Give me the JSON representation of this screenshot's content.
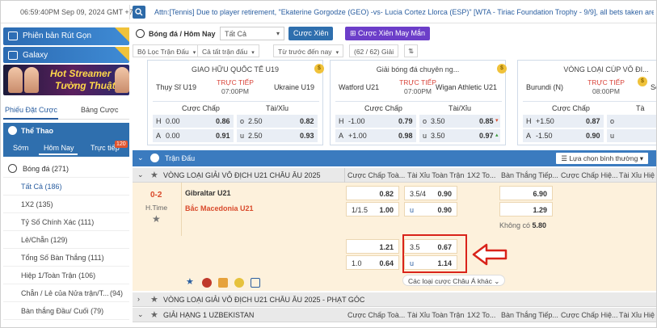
{
  "topbar": {
    "datetime": "06:59:40PM Sep 09, 2024 GMT +7",
    "ticker": "Attn:[Tennis] Due to player retirement, \"Ekaterine Gorgodze (GEO) -vs- Lucia Cortez Llorca (ESP)\" [WTA - Tiriac Foundation Trophy - 9/9], all bets taken are"
  },
  "sidebar": {
    "promo1": "Phiên bản Rút Gọn",
    "promo2": "Galaxy",
    "promo3_line1": "Hot Streamer",
    "promo3_line2": "Tường Thuật",
    "tabs": [
      "Phiếu Đặt Cược",
      "Bảng Cược"
    ],
    "sport_title": "Thể Thao",
    "modes": [
      "Sớm",
      "Hôm Nay",
      "Trực tiếp"
    ],
    "live_badge": "120",
    "items": [
      {
        "label": "Bóng đá",
        "count": "(271)"
      },
      {
        "label": "Tất Cả",
        "count": "(186)"
      },
      {
        "label": "1X2",
        "count": "(135)"
      },
      {
        "label": "Tỷ Số Chính Xác",
        "count": "(111)"
      },
      {
        "label": "Lẻ/Chẵn",
        "count": "(129)"
      },
      {
        "label": "Tổng Số Bàn Thắng",
        "count": "(111)"
      },
      {
        "label": "Hiệp 1/Toàn Trận",
        "count": "(106)"
      },
      {
        "label": "Chẵn / Lẻ của Nửa trận/T...",
        "count": "(94)"
      },
      {
        "label": "Bàn thắng Đầu/ Cuối",
        "count": "(79)"
      }
    ]
  },
  "toolbar": {
    "title": "Bóng đá / Hôm Nay",
    "select_value": "Tất Cả",
    "btn_parlay": "Cược Xiên",
    "btn_lucky": "Cược Xiên May Mắn",
    "filters": [
      "Bộ Lọc Trận Đấu",
      "Cả tất trận đấu",
      "Từ trước đến nay",
      "(62 / 62) Giải"
    ]
  },
  "cards": [
    {
      "league": "GIAO HỮU QUỐC TẾ U19",
      "home": "Thụy Sĩ U19",
      "away": "Ukraine U19",
      "status": "TRỰC TIẾP",
      "time": "07:00PM",
      "hdp_label": "Cược Chấp",
      "ou_label": "Tài/Xỉu",
      "r1": {
        "h": "H",
        "hv": "0.00",
        "ho": "0.86",
        "o": "o",
        "ov": "2.50",
        "oo": "0.82"
      },
      "r2": {
        "h": "A",
        "hv": "0.00",
        "ho": "0.91",
        "o": "u",
        "ov": "2.50",
        "oo": "0.93"
      }
    },
    {
      "league": "Giải bóng đá chuyên ng...",
      "home": "Watford U21",
      "away": "Wigan Athletic U21",
      "status": "TRỰC TIẾP",
      "time": "07:00PM",
      "hdp_label": "Cược Chấp",
      "ou_label": "Tài/Xỉu",
      "r1": {
        "h": "H",
        "hv": "-1.00",
        "ho": "0.79",
        "o": "o",
        "ov": "3.50",
        "oo": "0.85"
      },
      "r2": {
        "h": "A",
        "hv": "+1.00",
        "ho": "0.98",
        "o": "u",
        "ov": "3.50",
        "oo": "0.97"
      }
    },
    {
      "league": "VÒNG LOẠI CÚP VÔ ĐI...",
      "home": "Burundi (N)",
      "away": "Se",
      "status": "TRỰC TIẾP",
      "time": "08:00PM",
      "hdp_label": "Cược Chấp",
      "ou_label": "Tà",
      "r1": {
        "h": "H",
        "hv": "+1.50",
        "ho": "0.87",
        "o": "o",
        "ov": "",
        "oo": ""
      },
      "r2": {
        "h": "A",
        "hv": "-1.50",
        "ho": "0.90",
        "o": "u",
        "ov": "",
        "oo": ""
      }
    }
  ],
  "table": {
    "section_title": "Trận Đấu",
    "sort_label": "Lựa chọn bình thường",
    "leagues": [
      {
        "name": "VÒNG LOẠI GIẢI VÔ ĐỊCH U21 CHÂU ÂU 2025",
        "cols": [
          "Cược Chấp Toà...",
          "Tài Xỉu Toàn Trận",
          "1X2 To...",
          "Bàn Thắng Tiếp...",
          "Cược Chấp Hiệ...",
          "Tài Xỉu Hiệp 1"
        ]
      },
      {
        "name": "VÒNG LOẠI GIẢI VÔ ĐỊCH U21 CHÂU ÂU 2025 - PHẠT GÓC"
      },
      {
        "name": "GIẢI HẠNG 1 UZBEKISTAN",
        "cols": [
          "Cược Chấp Toà...",
          "Tài Xỉu Toàn Trận",
          "1X2 To...",
          "Bàn Thắng Tiếp...",
          "Cược Chấp Hiệ...",
          "Tài Xỉu Hiệp 1"
        ]
      }
    ],
    "match": {
      "score": "0-2",
      "period": "H.Time",
      "home": "Gibraltar U21",
      "away": "Bắc Macedonia U21",
      "hdp1": {
        "line": "",
        "odd": "0.82"
      },
      "hdp2": {
        "line": "1/1.5",
        "odd": "1.00"
      },
      "ou1": {
        "line": "3.5/4",
        "odd": "0.90"
      },
      "ou2": {
        "line": "u",
        "odd": "0.90"
      },
      "next1": "6.90",
      "next2": "1.29",
      "nodraw_label": "Không có",
      "nodraw_value": "5.80",
      "alt_hdp1": {
        "line": "",
        "odd": "1.21"
      },
      "alt_hdp2": {
        "line": "1.0",
        "odd": "0.64"
      },
      "alt_ou1": {
        "line": "3.5",
        "odd": "0.67"
      },
      "alt_ou2": {
        "line": "u",
        "odd": "1.14"
      },
      "more_label": "Các loại cược Châu Á khác"
    }
  }
}
